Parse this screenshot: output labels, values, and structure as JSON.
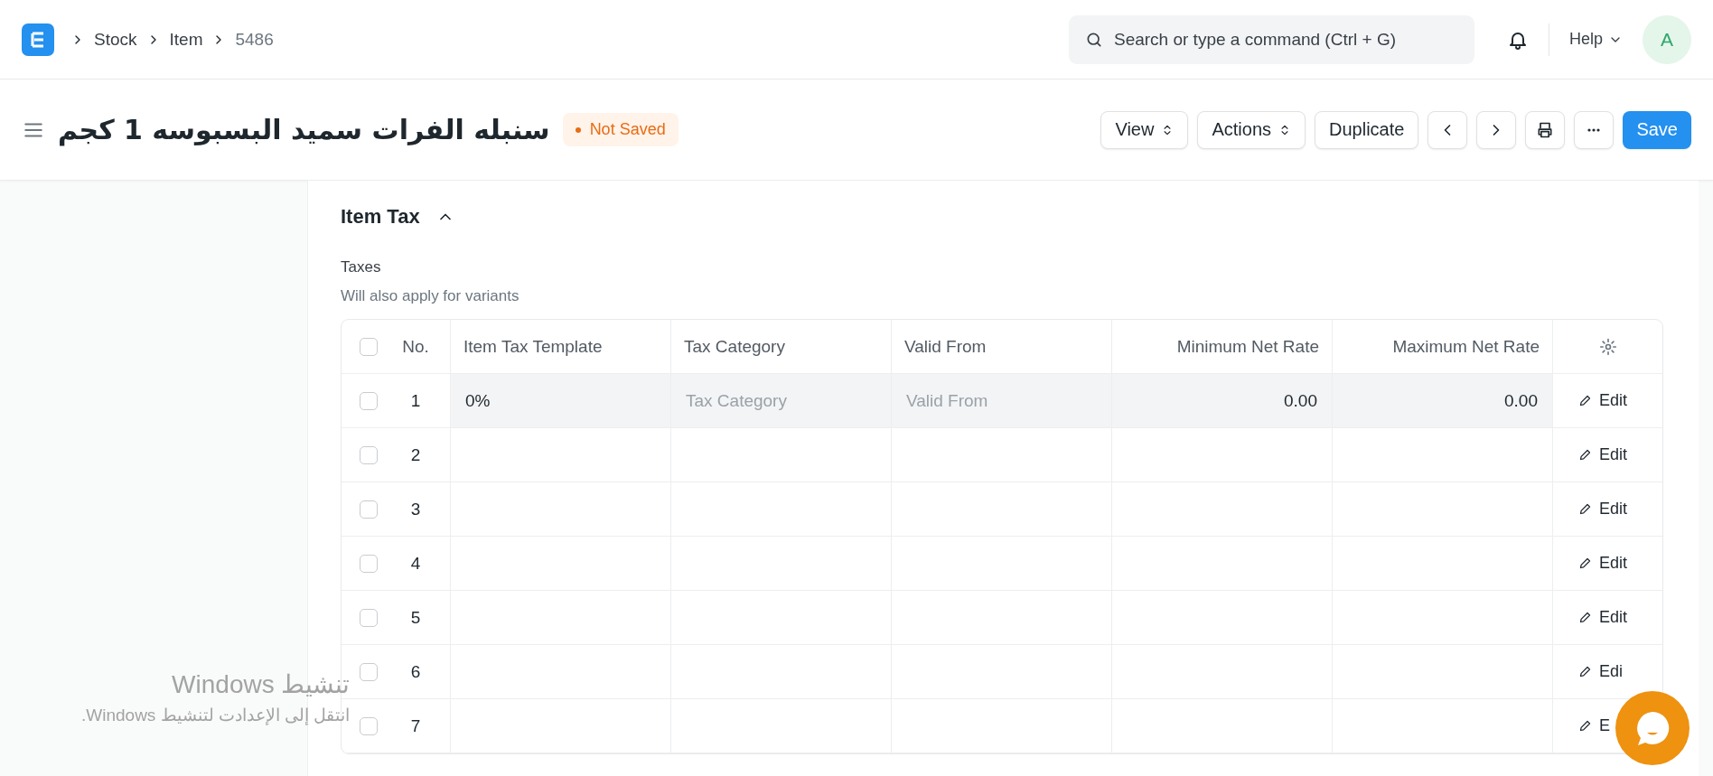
{
  "navbar": {
    "breadcrumbs": [
      "Stock",
      "Item",
      "5486"
    ],
    "search": {
      "placeholder": "Search or type a command (Ctrl + G)"
    },
    "help": "Help",
    "avatar": "A"
  },
  "page_header": {
    "title": "سنبله الفرات سميد البسبوسه 1 كجم",
    "status": "Not Saved",
    "buttons": [
      {
        "kind": "dropdown",
        "label": "View"
      },
      {
        "kind": "dropdown",
        "label": "Actions"
      },
      {
        "kind": "plain",
        "label": "Duplicate"
      },
      {
        "kind": "prev"
      },
      {
        "kind": "next"
      },
      {
        "kind": "print"
      },
      {
        "kind": "more"
      },
      {
        "kind": "primary",
        "label": "Save"
      }
    ]
  },
  "section": {
    "title": "Item Tax",
    "expanded": true,
    "field_label": "Taxes",
    "field_hint": "Will also apply for variants",
    "table": {
      "select_all_checked": false,
      "columns": [
        "No.",
        "Item Tax Template",
        "Tax Category",
        "Valid From",
        "Minimum Net Rate",
        "Maximum Net Rate"
      ],
      "rows": [
        {
          "active": true,
          "checked": false,
          "cells": [
            {
              "value": "1"
            },
            {
              "value": "0%"
            },
            {
              "placeholder": "Tax Category"
            },
            {
              "placeholder": "Valid From"
            },
            {
              "value": "0.00"
            },
            {
              "value": "0.00"
            }
          ],
          "edit": "Edit"
        },
        {
          "active": false,
          "checked": false,
          "cells": [
            {
              "value": "2"
            },
            {},
            {},
            {},
            {},
            {}
          ],
          "edit": "Edit"
        },
        {
          "active": false,
          "checked": false,
          "cells": [
            {
              "value": "3"
            },
            {},
            {},
            {},
            {},
            {}
          ],
          "edit": "Edit"
        },
        {
          "active": false,
          "checked": false,
          "cells": [
            {
              "value": "4"
            },
            {},
            {},
            {},
            {},
            {}
          ],
          "edit": "Edit"
        },
        {
          "active": false,
          "checked": false,
          "cells": [
            {
              "value": "5"
            },
            {},
            {},
            {},
            {},
            {}
          ],
          "edit": "Edit"
        },
        {
          "active": false,
          "checked": false,
          "cells": [
            {
              "value": "6"
            },
            {},
            {},
            {},
            {},
            {}
          ],
          "edit": "Edi"
        },
        {
          "active": false,
          "checked": false,
          "cells": [
            {
              "value": "7"
            },
            {},
            {},
            {},
            {},
            {}
          ],
          "edit": "E"
        }
      ]
    }
  },
  "os_overlay": {
    "title": "تنشيط Windows",
    "message": "انتقل إلى الإعدادت لتنشيط Windows."
  }
}
